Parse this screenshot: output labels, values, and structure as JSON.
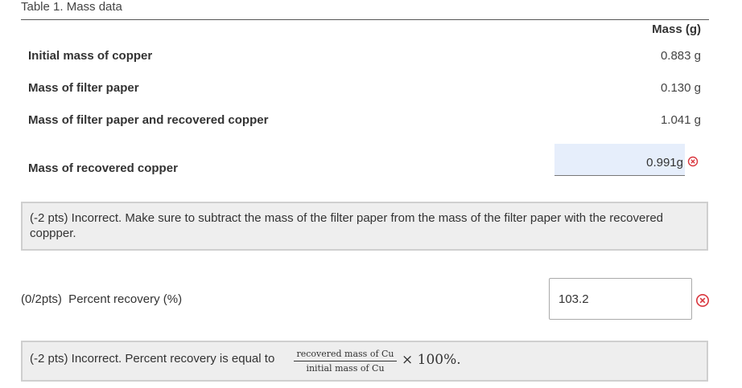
{
  "table": {
    "caption": "Table 1. Mass data",
    "column_header": "Mass (g)",
    "rows": [
      {
        "label": "Initial mass of copper",
        "value": "0.883 g"
      },
      {
        "label": "Mass of filter paper",
        "value": "0.130 g"
      },
      {
        "label": "Mass of filter paper and recovered copper",
        "value": "1.041 g"
      }
    ],
    "answer_row": {
      "label": "Mass of recovered copper",
      "value": "0.991g",
      "status_icon": "incorrect-x-icon"
    }
  },
  "feedback1": "(-2 pts) Incorrect. Make sure to subtract the mass of the filter paper from the mass of the filter paper with the recovered coppper.",
  "percent_recovery": {
    "label": "(0/2pts)  Percent recovery (%)",
    "value": "103.2",
    "status_icon": "incorrect-x-icon"
  },
  "feedback2": {
    "text": "(-2 pts) Incorrect. Percent recovery is equal to",
    "numerator": "recovered mass of Cu",
    "denominator": "initial mass of Cu",
    "tail": "× 100%."
  },
  "colors": {
    "error": "#d9363e",
    "answer_bg": "#e6eefb",
    "feedback_bg": "#eeeeee"
  }
}
